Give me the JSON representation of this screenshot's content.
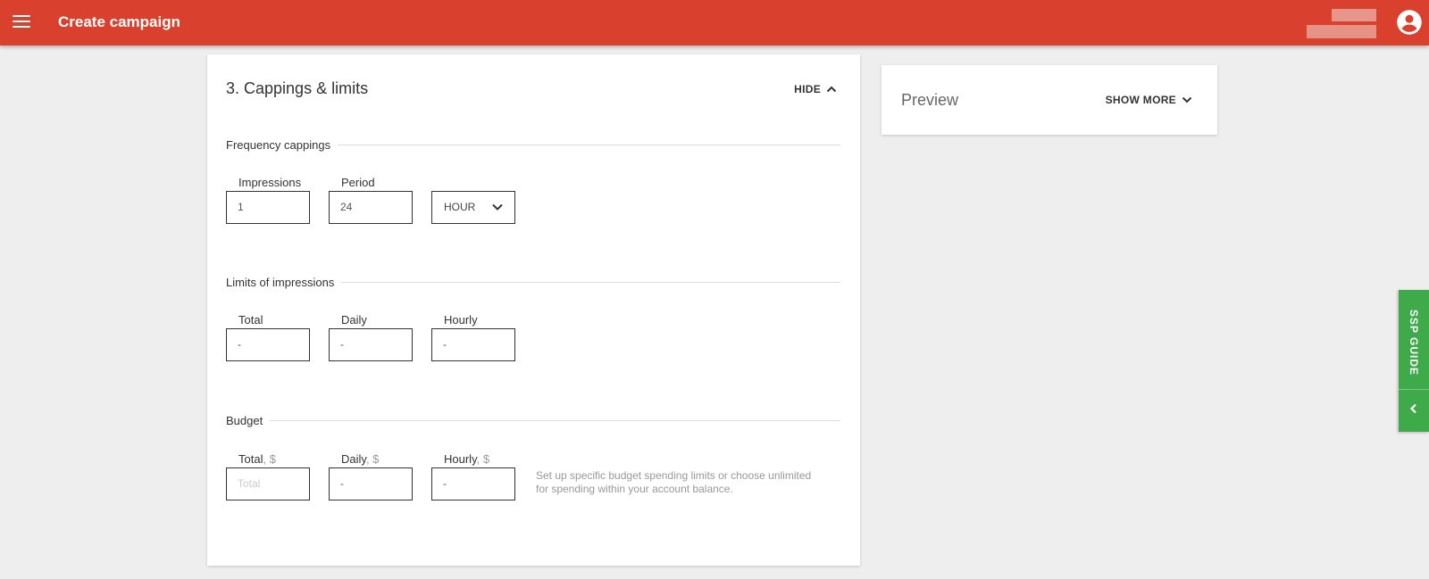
{
  "app": {
    "title": "Create campaign"
  },
  "colors": {
    "topbar": "#d9412e",
    "guide_tab": "#3eaa49"
  },
  "icons": {
    "menu": "hamburger-menu-icon",
    "account": "account-circle-icon",
    "hide": "chevron-up-icon",
    "show_more": "chevron-down-icon",
    "select": "chevron-down-icon",
    "guide": "chevron-left-icon"
  },
  "main_card": {
    "title": "3. Cappings & limits",
    "hide_label": "HIDE",
    "frequency": {
      "title": "Frequency cappings",
      "impressions_label": "Impressions",
      "impressions_value": "1",
      "period_label": "Period",
      "period_value": "24",
      "unit_selected": "HOUR"
    },
    "limits": {
      "title": "Limits of impressions",
      "total_label": "Total",
      "total_value": "-",
      "daily_label": "Daily",
      "daily_value": "-",
      "hourly_label": "Hourly",
      "hourly_value": "-"
    },
    "budget": {
      "title": "Budget",
      "total_label": "Total",
      "total_placeholder": "Total",
      "daily_label": "Daily",
      "daily_value": "-",
      "hourly_label": "Hourly",
      "hourly_value": "-",
      "currency_suffix": ", $",
      "hint": "Set up specific budget spending limits or choose unlimited for spending within your account balance."
    }
  },
  "preview": {
    "title": "Preview",
    "show_more_label": "SHOW MORE"
  },
  "guide_tab": {
    "label": "SSP GUIDE"
  }
}
